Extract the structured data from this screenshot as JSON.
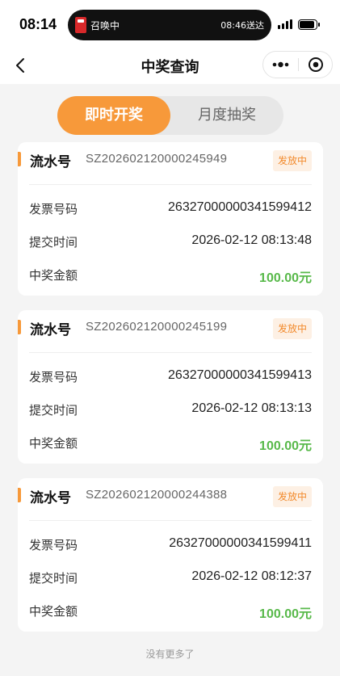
{
  "status_bar": {
    "time": "08:14",
    "island_left_text": "召唤中",
    "island_right_text": "08:46送达"
  },
  "nav": {
    "title": "中奖查询"
  },
  "tabs": [
    {
      "label": "即时开奖",
      "active": true
    },
    {
      "label": "月度抽奖",
      "active": false
    }
  ],
  "labels": {
    "serial": "流水号",
    "invoice_no": "发票号码",
    "submit_time": "提交时间",
    "prize_amount": "中奖金额"
  },
  "records": [
    {
      "serial": "SZ202602120000245949",
      "status": "发放中",
      "invoice_no": "26327000000341599412",
      "submit_time": "2026-02-12 08:13:48",
      "amount": "100.00元"
    },
    {
      "serial": "SZ202602120000245199",
      "status": "发放中",
      "invoice_no": "26327000000341599413",
      "submit_time": "2026-02-12 08:13:13",
      "amount": "100.00元"
    },
    {
      "serial": "SZ202602120000244388",
      "status": "发放中",
      "invoice_no": "26327000000341599411",
      "submit_time": "2026-02-12 08:12:37",
      "amount": "100.00元"
    }
  ],
  "footer": "没有更多了",
  "colors": {
    "accent": "#f7993a",
    "amount_green": "#58b94a",
    "badge_text": "#f28a2c",
    "badge_bg": "#fdf0e4"
  },
  "icons": [
    "back-icon",
    "more-icon",
    "close-icon",
    "signal-icon",
    "battery-icon",
    "delivery-icon"
  ]
}
